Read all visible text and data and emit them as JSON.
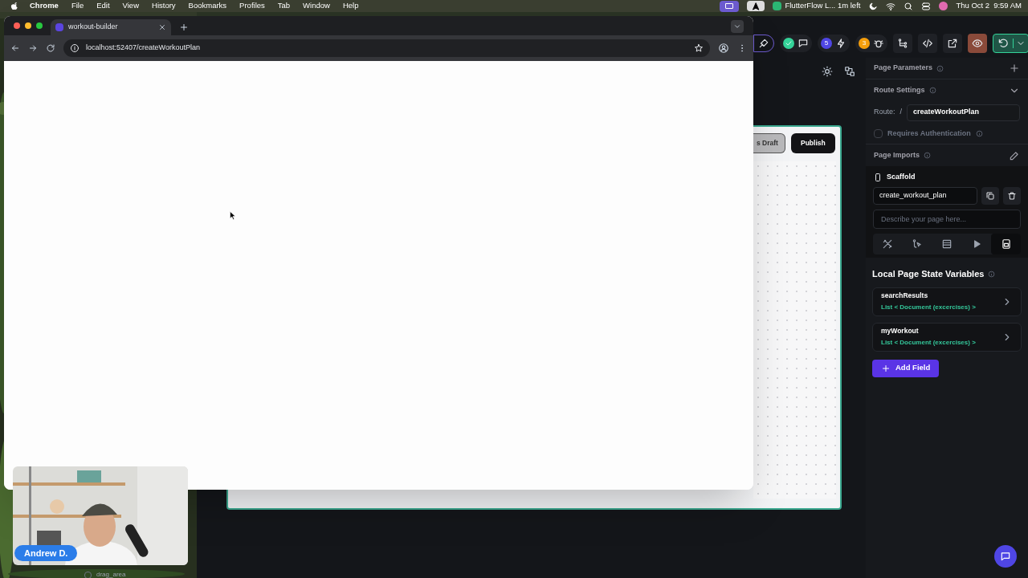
{
  "menu_bar": {
    "app": "Chrome",
    "menus": [
      "File",
      "Edit",
      "View",
      "History",
      "Bookmarks",
      "Profiles",
      "Tab",
      "Window",
      "Help"
    ],
    "status_text": "FlutterFlow L... 1m left",
    "date": "Thu Oct 2",
    "time": "9:59 AM"
  },
  "browser": {
    "tab_title": "workout-builder",
    "url": "localhost:52407/createWorkoutPlan"
  },
  "editor": {
    "toolbar": {
      "badges": [
        {
          "count": "5",
          "color": "#4f46e5"
        },
        {
          "count": "3",
          "color": "#f59e0b"
        }
      ]
    },
    "canvas": {
      "buttons": [
        {
          "kind": "secondary",
          "label": "s Draft"
        },
        {
          "kind": "primary",
          "label": "Publish"
        }
      ]
    },
    "panel": {
      "page_parameters": "Page Parameters",
      "route_settings": "Route Settings",
      "route_label": "Route:",
      "route_slash": "/",
      "route_value": "createWorkoutPlan",
      "auth": {
        "label": "Requires Authentication",
        "checked": false
      },
      "page_imports": "Page Imports",
      "widget": "Scaffold",
      "page_name": "create_workout_plan",
      "description": {
        "placeholder": "Describe your page here..."
      },
      "tool_tabs": [
        {
          "selected": false
        },
        {
          "selected": false
        },
        {
          "selected": false
        },
        {
          "selected": false
        },
        {
          "selected": true
        }
      ],
      "state_title": "Local Page State Variables",
      "variables": [
        {
          "name": "searchResults",
          "type": "List < Document (excercises) >"
        },
        {
          "name": "myWorkout",
          "type": "List < Document (excercises) >"
        }
      ],
      "add_button": "Add Field"
    },
    "bottom_layer": {
      "label": "drag_area",
      "checked": false
    }
  },
  "webcam": {
    "name": "Andrew D."
  }
}
